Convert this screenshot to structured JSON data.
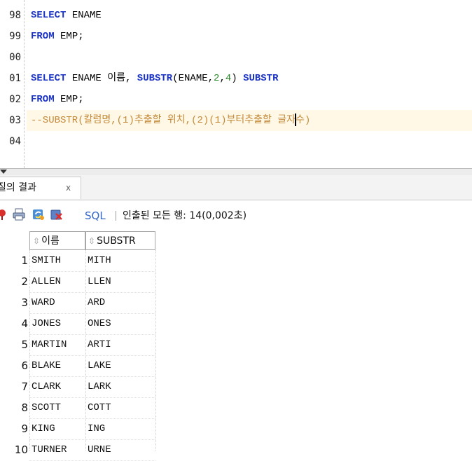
{
  "editor": {
    "line_numbers": [
      "98",
      "99",
      "00",
      "01",
      "02",
      "03",
      "04"
    ],
    "lines": [
      {
        "segments": [
          {
            "t": "SELECT",
            "c": "kw"
          },
          {
            "t": " ENAME",
            "c": "id"
          }
        ]
      },
      {
        "segments": [
          {
            "t": "FROM",
            "c": "kw"
          },
          {
            "t": " EMP;",
            "c": "id"
          }
        ]
      },
      {
        "segments": []
      },
      {
        "segments": [
          {
            "t": "SELECT",
            "c": "kw"
          },
          {
            "t": " ENAME 이름, ",
            "c": "id"
          },
          {
            "t": "SUBSTR",
            "c": "kw"
          },
          {
            "t": "(ENAME,",
            "c": "id"
          },
          {
            "t": "2",
            "c": "num"
          },
          {
            "t": ",",
            "c": "id"
          },
          {
            "t": "4",
            "c": "num"
          },
          {
            "t": ") ",
            "c": "id"
          },
          {
            "t": "SUBSTR",
            "c": "kw"
          }
        ]
      },
      {
        "segments": [
          {
            "t": "FROM",
            "c": "kw"
          },
          {
            "t": " EMP;",
            "c": "id"
          }
        ]
      },
      {
        "segments": [
          {
            "t": "--SUBSTR(칼럼명,(1)추출할 위치,(2)(1)부터추출할 글자",
            "c": "cmt"
          },
          {
            "t": "|",
            "c": "caret"
          },
          {
            "t": "수)",
            "c": "cmt"
          }
        ],
        "current": true
      },
      {
        "segments": []
      }
    ]
  },
  "result_tab": {
    "label": "질의 결과",
    "close": "x"
  },
  "toolbar": {
    "icons": [
      "pin-icon",
      "print-icon",
      "refresh-icon",
      "export-icon"
    ],
    "sql_label": "SQL",
    "separator": "|",
    "status": "인출된 모든 행: 14(0,002초)"
  },
  "grid": {
    "columns": [
      {
        "sort_icon": "⇳",
        "label": "이름"
      },
      {
        "sort_icon": "⇳",
        "label": "SUBSTR"
      }
    ],
    "rows": [
      {
        "n": "1",
        "name": "SMITH",
        "sub": "MITH"
      },
      {
        "n": "2",
        "name": "ALLEN",
        "sub": "LLEN"
      },
      {
        "n": "3",
        "name": "WARD",
        "sub": "ARD"
      },
      {
        "n": "4",
        "name": "JONES",
        "sub": "ONES"
      },
      {
        "n": "5",
        "name": "MARTIN",
        "sub": "ARTI"
      },
      {
        "n": "6",
        "name": "BLAKE",
        "sub": "LAKE"
      },
      {
        "n": "7",
        "name": "CLARK",
        "sub": "LARK"
      },
      {
        "n": "8",
        "name": "SCOTT",
        "sub": "COTT"
      },
      {
        "n": "9",
        "name": "KING",
        "sub": "ING"
      },
      {
        "n": "10",
        "name": "TURNER",
        "sub": "URNE"
      }
    ]
  }
}
